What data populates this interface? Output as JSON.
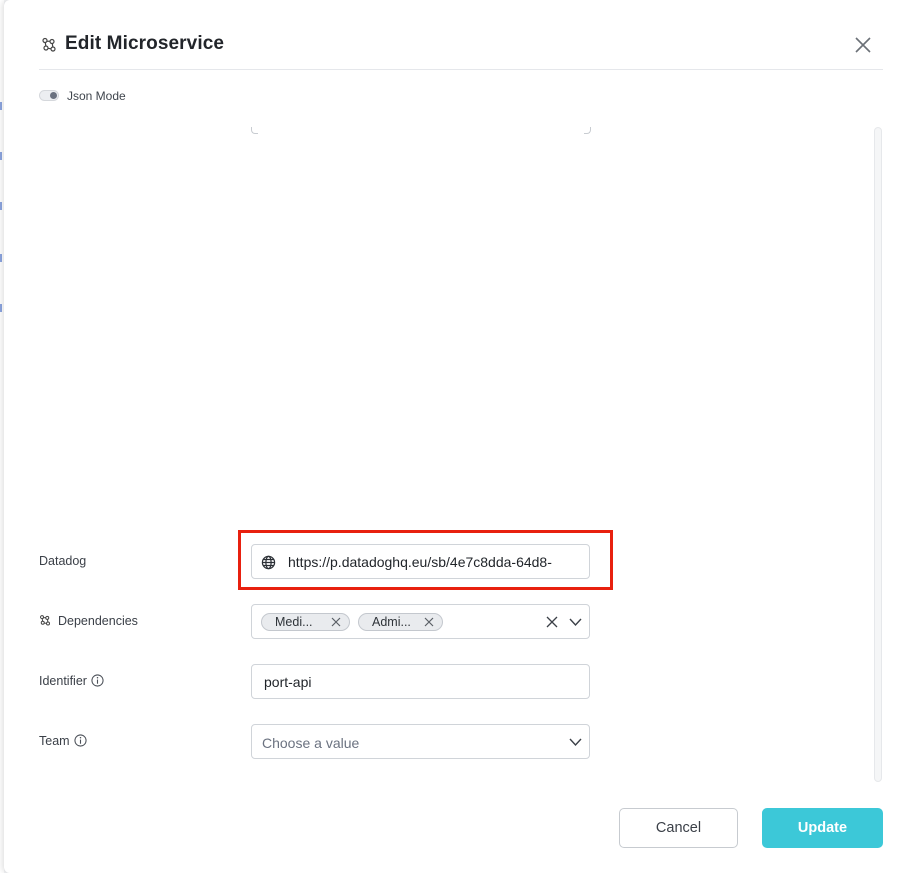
{
  "dialog": {
    "title": "Edit Microservice",
    "title_icon": "microservice-icon",
    "close_icon": "close-icon"
  },
  "json_mode": {
    "label": "Json Mode",
    "enabled": false
  },
  "form": {
    "datadog": {
      "label": "Datadog",
      "value": "https://p.datadoghq.eu/sb/4e7c8dda-64d8-",
      "icon": "globe-icon"
    },
    "dependencies": {
      "label": "Dependencies",
      "icon": "microservice-icon",
      "chips": [
        "Medi...",
        "Admi..."
      ]
    },
    "identifier": {
      "label": "Identifier",
      "value": "port-api"
    },
    "team": {
      "label": "Team",
      "placeholder": "Choose a value"
    }
  },
  "buttons": {
    "cancel": "Cancel",
    "update": "Update"
  },
  "colors": {
    "accent": "#3cc8d8",
    "highlight": "#e8200f"
  }
}
